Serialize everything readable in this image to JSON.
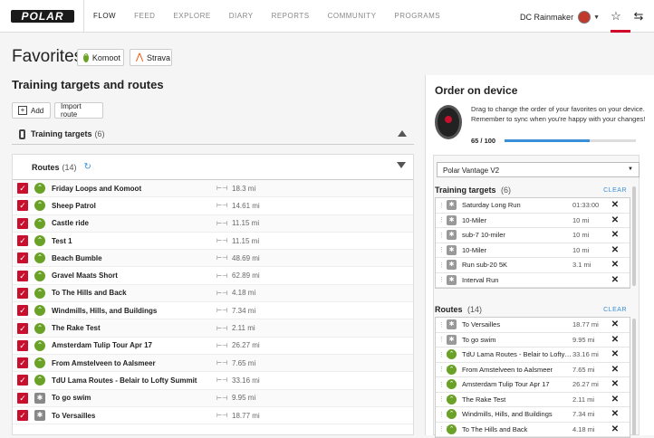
{
  "nav": {
    "logo": "POLAR",
    "items": [
      "FLOW",
      "FEED",
      "EXPLORE",
      "DIARY",
      "REPORTS",
      "COMMUNITY",
      "PROGRAMS"
    ],
    "user_name": "DC Rainmaker",
    "star_icon": "star-icon",
    "sync_icon": "sync-icon"
  },
  "favorites": {
    "title": "Favorites",
    "komoot_label": "Komoot",
    "strava_label": "Strava"
  },
  "training": {
    "title": "Training targets and routes",
    "add_label": "Add",
    "import_label": "Import route",
    "targets_label": "Training targets",
    "targets_count": "(6)",
    "routes_label": "Routes",
    "routes_count": "(14)"
  },
  "routes": [
    {
      "name": "Friday Loops and Komoot",
      "dist": "18.3 mi",
      "icon": "komoot"
    },
    {
      "name": "Sheep Patrol",
      "dist": "14.61 mi",
      "icon": "komoot"
    },
    {
      "name": "Castle ride",
      "dist": "11.15 mi",
      "icon": "komoot"
    },
    {
      "name": "Test 1",
      "dist": "11.15 mi",
      "icon": "komoot"
    },
    {
      "name": "Beach Bumble",
      "dist": "48.69 mi",
      "icon": "komoot"
    },
    {
      "name": "Gravel Maats Short",
      "dist": "62.89 mi",
      "icon": "komoot"
    },
    {
      "name": "To The Hills and Back",
      "dist": "4.18 mi",
      "icon": "komoot"
    },
    {
      "name": "Windmills, Hills, and Buildings",
      "dist": "7.34 mi",
      "icon": "komoot"
    },
    {
      "name": "The Rake Test",
      "dist": "2.11 mi",
      "icon": "komoot"
    },
    {
      "name": "Amsterdam Tulip Tour Apr 17",
      "dist": "26.27 mi",
      "icon": "komoot"
    },
    {
      "name": "From Amstelveen to Aalsmeer",
      "dist": "7.65 mi",
      "icon": "komoot"
    },
    {
      "name": "TdU Lama Routes - Belair to Lofty Summit",
      "dist": "33.16 mi",
      "icon": "komoot"
    },
    {
      "name": "To go swim",
      "dist": "9.95 mi",
      "icon": "sport"
    },
    {
      "name": "To Versailles",
      "dist": "18.77 mi",
      "icon": "sport"
    }
  ],
  "order": {
    "title": "Order on device",
    "description": "Drag to change the order of your favorites on your device. Remember to sync when you're happy with your changes!",
    "progress_text": "65 / 100",
    "progress": 0.65,
    "device": "Polar Vantage V2",
    "targets_label": "Training targets",
    "targets_count": "(6)",
    "routes_label": "Routes",
    "routes_count": "(14)",
    "clear_label": "CLEAR",
    "targets": [
      {
        "name": "Saturday Long Run",
        "value": "01:33:00"
      },
      {
        "name": "10-Miler",
        "value": "10 mi"
      },
      {
        "name": "sub-7 10-miler",
        "value": "10 mi"
      },
      {
        "name": "10-Miler",
        "value": "10 mi"
      },
      {
        "name": "Run sub-20 5K",
        "value": "3.1 mi"
      },
      {
        "name": "Interval Run",
        "value": ""
      }
    ],
    "routes": [
      {
        "name": "To Versailles",
        "value": "18.77 mi",
        "icon": "sport"
      },
      {
        "name": "To go swim",
        "value": "9.95 mi",
        "icon": "sport"
      },
      {
        "name": "TdU Lama Routes - Belair to Lofty Summit",
        "value": "33.16 mi",
        "icon": "komoot"
      },
      {
        "name": "From Amstelveen to Aalsmeer",
        "value": "7.65 mi",
        "icon": "komoot"
      },
      {
        "name": "Amsterdam Tulip Tour Apr 17",
        "value": "26.27 mi",
        "icon": "komoot"
      },
      {
        "name": "The Rake Test",
        "value": "2.11 mi",
        "icon": "komoot"
      },
      {
        "name": "Windmills, Hills, and Buildings",
        "value": "7.34 mi",
        "icon": "komoot"
      },
      {
        "name": "To The Hills and Back",
        "value": "4.18 mi",
        "icon": "komoot"
      }
    ]
  }
}
